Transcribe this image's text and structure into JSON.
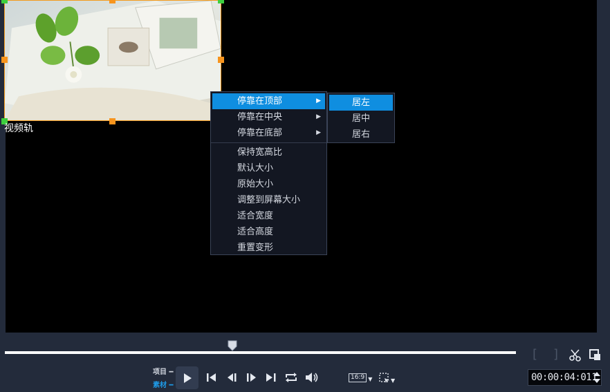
{
  "preview": {
    "track_label": "视频轨"
  },
  "context_menu": {
    "items": [
      {
        "label": "停靠在顶部",
        "submenu": true,
        "active": true
      },
      {
        "label": "停靠在中央",
        "submenu": true
      },
      {
        "label": "停靠在底部",
        "submenu": true
      }
    ],
    "items2": [
      {
        "label": "保持宽高比"
      },
      {
        "label": "默认大小"
      },
      {
        "label": "原始大小"
      },
      {
        "label": "调整到屏幕大小"
      },
      {
        "label": "适合宽度"
      },
      {
        "label": "适合高度"
      },
      {
        "label": "重置变形"
      }
    ],
    "arrow": "▶"
  },
  "submenu": {
    "items": [
      {
        "label": "居左",
        "active": true
      },
      {
        "label": "居中"
      },
      {
        "label": "居右"
      }
    ]
  },
  "playback": {
    "project_label": "项目",
    "clip_label": "素材",
    "aspect_label": "16:9",
    "timecode": "00:00:04:011"
  },
  "colors": {
    "accent": "#0f8ee0",
    "handle": "#f7941d",
    "clip_label_color": "#1e9be8"
  }
}
